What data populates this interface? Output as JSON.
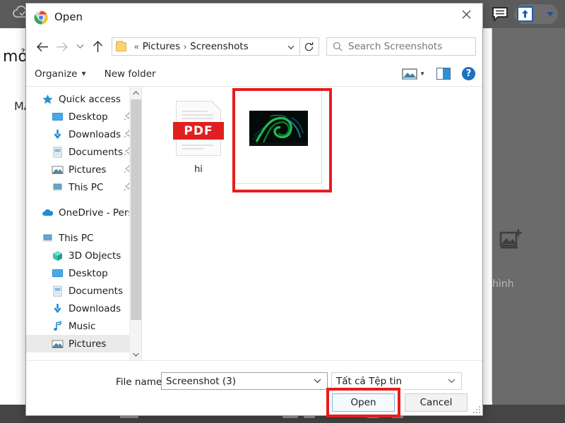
{
  "background": {
    "toolbar": {
      "cloud_icon": "cloud-icon",
      "comment_icon": "comment-icon",
      "upload_icon": "upload-icon",
      "upload_caret_icon": "chevron-down-icon"
    },
    "page": {
      "text_1": "mở",
      "text_2": "MÁ"
    },
    "right_pane": {
      "add_image_icon": "add-image-icon",
      "label": "hình"
    }
  },
  "dialog": {
    "title": "Open",
    "title_icon": "chrome-icon",
    "close_icon": "close-icon",
    "nav": {
      "back_icon": "arrow-left-icon",
      "forward_icon": "arrow-right-icon",
      "recent_icon": "chevron-down-icon",
      "up_icon": "arrow-up-icon",
      "breadcrumb_folder_icon": "folder-icon",
      "breadcrumb_overflow": "«",
      "breadcrumb": [
        "Pictures",
        "Screenshots"
      ],
      "breadcrumb_separator": "›",
      "breadcrumb_caret_icon": "chevron-down-icon",
      "refresh_icon": "refresh-icon"
    },
    "search": {
      "icon": "search-icon",
      "placeholder": "Search Screenshots",
      "value": ""
    },
    "toolbar": {
      "organize_label": "Organize",
      "organize_caret_icon": "chevron-down-icon",
      "new_folder_label": "New folder",
      "view_icon": "view-layout-icon",
      "view_caret_icon": "chevron-down-icon",
      "preview_pane_icon": "preview-pane-icon",
      "help_icon": "help-icon",
      "help_glyph": "?"
    },
    "sidebar": {
      "groups": [
        {
          "header": {
            "label": "Quick access",
            "icon": "star-icon"
          },
          "items": [
            {
              "label": "Desktop",
              "icon": "desktop-icon",
              "pinned": true
            },
            {
              "label": "Downloads",
              "icon": "downloads-icon",
              "pinned": true
            },
            {
              "label": "Documents",
              "icon": "documents-icon",
              "pinned": true
            },
            {
              "label": "Pictures",
              "icon": "pictures-icon",
              "pinned": true
            },
            {
              "label": "This PC",
              "icon": "thispc-icon",
              "pinned": true
            }
          ]
        },
        {
          "header": {
            "label": "OneDrive - Personal",
            "icon": "onedrive-icon"
          },
          "items": []
        },
        {
          "header": {
            "label": "This PC",
            "icon": "thispc-icon"
          },
          "items": [
            {
              "label": "3D Objects",
              "icon": "3dobjects-icon",
              "pinned": false
            },
            {
              "label": "Desktop",
              "icon": "desktop-icon",
              "pinned": false
            },
            {
              "label": "Documents",
              "icon": "documents-icon",
              "pinned": false
            },
            {
              "label": "Downloads",
              "icon": "downloads-icon",
              "pinned": false
            },
            {
              "label": "Music",
              "icon": "music-icon",
              "pinned": false
            },
            {
              "label": "Pictures",
              "icon": "pictures-icon",
              "pinned": false,
              "selected": true
            }
          ]
        }
      ],
      "scrollbar": {
        "up_icon": "chevron-up-icon",
        "down_icon": "chevron-down-icon"
      }
    },
    "files": [
      {
        "name": "hi",
        "type": "pdf",
        "badge": "PDF",
        "selected": false
      },
      {
        "name": "Screenshot (3)",
        "type": "image",
        "selected": true
      }
    ],
    "footer": {
      "file_name_label": "File name:",
      "file_name_value": "Screenshot (3)",
      "file_name_caret_icon": "chevron-down-icon",
      "file_type_value": "Tất cả Tệp tin",
      "file_type_caret_icon": "chevron-down-icon",
      "open_label": "Open",
      "cancel_label": "Cancel"
    },
    "annotations": {
      "highlight_color": "#e81c1c",
      "boxes": [
        "selected-file-highlight",
        "open-button-highlight"
      ]
    }
  }
}
